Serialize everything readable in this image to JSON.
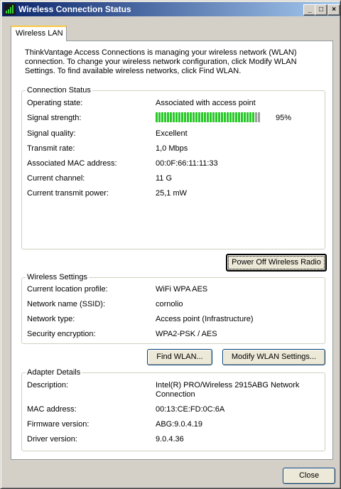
{
  "window": {
    "title": "Wireless Connection Status"
  },
  "titlebar_buttons": {
    "minimize": "_",
    "maximize": "□",
    "close": "×"
  },
  "tab": {
    "label": "Wireless LAN"
  },
  "intro_text": "ThinkVantage Access Connections is managing your wireless network (WLAN) connection. To change your wireless network configuration, click Modify WLAN Settings. To find available wireless networks, click Find WLAN.",
  "connection_status": {
    "title": "Connection Status",
    "rows": [
      {
        "label": "Operating state:",
        "value": "Associated with access point"
      },
      {
        "label": "Signal strength:",
        "value": "95%"
      },
      {
        "label": "Signal quality:",
        "value": "Excellent"
      },
      {
        "label": "Transmit rate:",
        "value": "1,0 Mbps"
      },
      {
        "label": "Associated MAC address:",
        "value": "00:0F:66:11:11:33"
      },
      {
        "label": "Current channel:",
        "value": "11 G"
      },
      {
        "label": "Current transmit power:",
        "value": "25,1 mW"
      }
    ],
    "signal_level": 0.95
  },
  "power_off_button": {
    "label": "Power Off Wireless Radio"
  },
  "wireless_settings": {
    "title": "Wireless Settings",
    "rows": [
      {
        "label": "Current location profile:",
        "value": "WiFi WPA AES"
      },
      {
        "label": "Network name (SSID):",
        "value": "cornolio"
      },
      {
        "label": "Network type:",
        "value": "Access point (Infrastructure)"
      },
      {
        "label": "Security encryption:",
        "value": "WPA2-PSK / AES"
      }
    ]
  },
  "find_wlan_button": {
    "label": "Find WLAN..."
  },
  "modify_wlan_button": {
    "label": "Modify WLAN Settings..."
  },
  "adapter_details": {
    "title": "Adapter Details",
    "rows": [
      {
        "label": "Description:",
        "value": "Intel(R) PRO/Wireless 2915ABG Network Connection"
      },
      {
        "label": "MAC address:",
        "value": "00:13:CE:FD:0C:6A"
      },
      {
        "label": "Firmware version:",
        "value": "ABG:9.0.4.19"
      },
      {
        "label": "Driver version:",
        "value": "9.0.4.36"
      }
    ]
  },
  "close_button": {
    "label": "Close"
  },
  "colors": {
    "titlebar": "#0a246a",
    "signal_on": "#28c828",
    "signal_off": "#a0a0a0"
  }
}
